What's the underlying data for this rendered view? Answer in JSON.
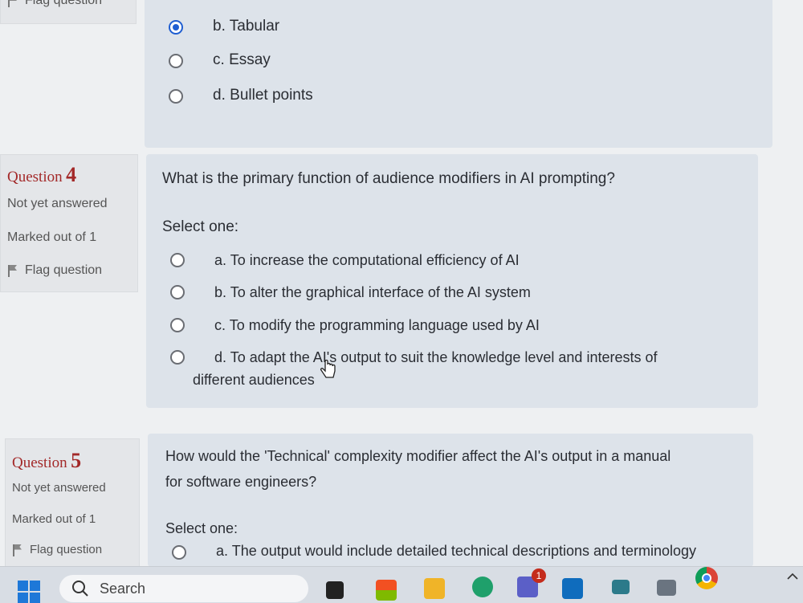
{
  "previous_question": {
    "flag_label": "Flag question",
    "options": [
      {
        "letter": "b.",
        "text": "Tabular",
        "selected": true
      },
      {
        "letter": "c.",
        "text": "Essay",
        "selected": false
      },
      {
        "letter": "d.",
        "text": "Bullet points",
        "selected": false
      }
    ]
  },
  "q4": {
    "label": "Question",
    "number": "4",
    "status": "Not yet answered",
    "marked": "Marked out of 1",
    "flag": "Flag question",
    "text": "What is the primary function of audience modifiers in AI prompting?",
    "select_one": "Select one:",
    "options": [
      {
        "letter": "a.",
        "text": "To increase the computational efficiency of AI"
      },
      {
        "letter": "b.",
        "text": "To alter the graphical interface of the AI system"
      },
      {
        "letter": "c.",
        "text": "To modify the programming language used by AI"
      },
      {
        "letter": "d.",
        "text": "To adapt the AI's output to suit the knowledge level and interests of",
        "text2": "different audiences"
      }
    ]
  },
  "q5": {
    "label": "Question",
    "number": "5",
    "status": "Not yet answered",
    "marked": "Marked out of 1",
    "flag": "Flag question",
    "text1": "How would the 'Technical' complexity modifier affect the AI's output in a manual",
    "text2": "for software engineers?",
    "select_one": "Select one:",
    "options": [
      {
        "letter": "a.",
        "text": "The output would include detailed technical descriptions and terminology"
      }
    ]
  },
  "taskbar": {
    "search_label": "Search",
    "teams_badge": "1"
  }
}
